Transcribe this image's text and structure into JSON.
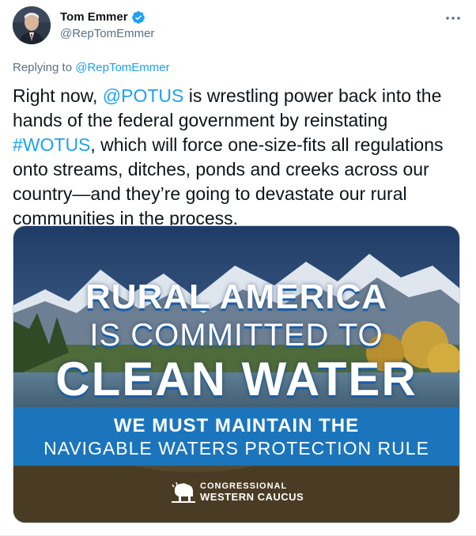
{
  "author": {
    "display_name": "Tom Emmer",
    "handle": "@RepTomEmmer",
    "verified": true
  },
  "reply_context": {
    "prefix": "Replying to",
    "to": "@RepTomEmmer"
  },
  "tweet": {
    "text_1": "Right now, ",
    "mention": "@POTUS",
    "text_2": " is wrestling power back into the hands of the federal government by reinstating ",
    "hashtag": "#WOTUS",
    "text_3": ", which will force one-size-fits all regulations onto streams, ditches, ponds and creeks across our country—and they’re going to devastate our rural communities in the process."
  },
  "media": {
    "headline_1": "RURAL AMERICA",
    "headline_2": "IS COMMITTED TO",
    "headline_3": "CLEAN WATER",
    "banner_1": "WE MUST MAINTAIN THE",
    "banner_2": "NAVIGABLE WATERS PROTECTION RULE",
    "logo_line_1": "CONGRESSIONAL",
    "logo_line_2": "WESTERN CAUCUS"
  },
  "colors": {
    "link": "#1da1f2",
    "secondary_text": "#5b7083",
    "banner": "#1b75bc",
    "verified": "#1da1f2"
  },
  "icons": [
    "verified-badge-icon",
    "more-options-icon",
    "bison-logo-icon"
  ]
}
